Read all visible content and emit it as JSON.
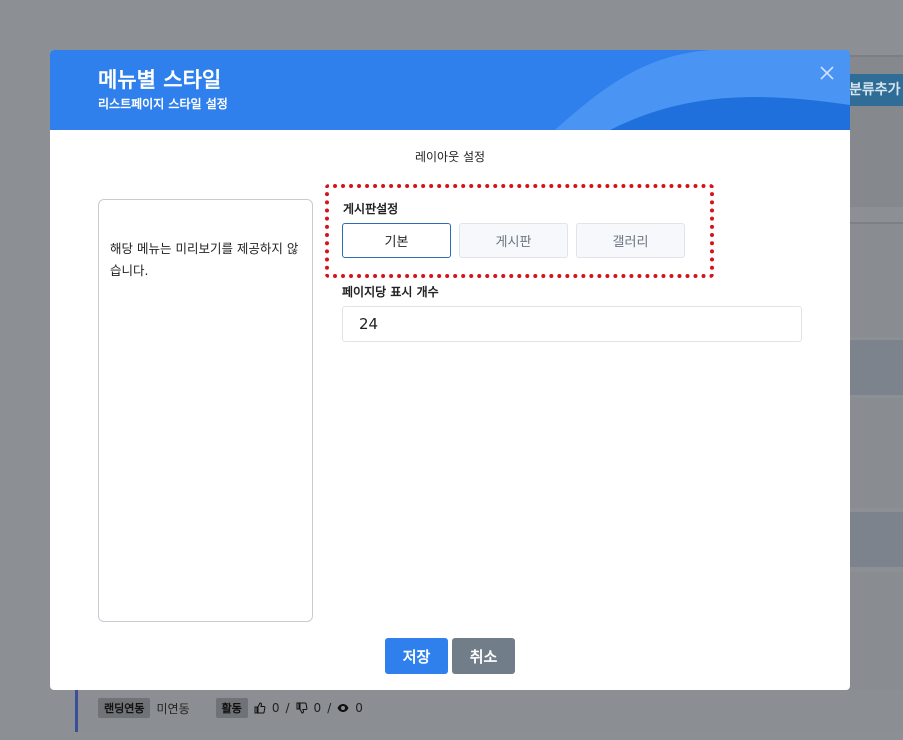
{
  "background": {
    "tag_label": "분류추가",
    "footer": {
      "chip1": "랜딩연동",
      "chip1_value": "미연동",
      "chip2": "활동",
      "likes": "0",
      "dislikes": "0",
      "views": "0",
      "sep": "/"
    }
  },
  "modal": {
    "title": "메뉴별 스타일",
    "subtitle": "리스트페이지 스타일 설정",
    "section_label": "레이아웃 설정",
    "preview_text": "해당 메뉴는 미리보기를 제공하지 않습니다.",
    "board_setting_label": "게시판설정",
    "options": [
      {
        "label": "기본",
        "active": true
      },
      {
        "label": "게시판",
        "active": false
      },
      {
        "label": "갤러리",
        "active": false
      }
    ],
    "per_page_label": "페이지당 표시 개수",
    "per_page_value": "24",
    "save_label": "저장",
    "cancel_label": "취소",
    "colors": {
      "header": "#2f80ed",
      "highlight": "#d4141a",
      "cancel": "#727d8a"
    }
  }
}
